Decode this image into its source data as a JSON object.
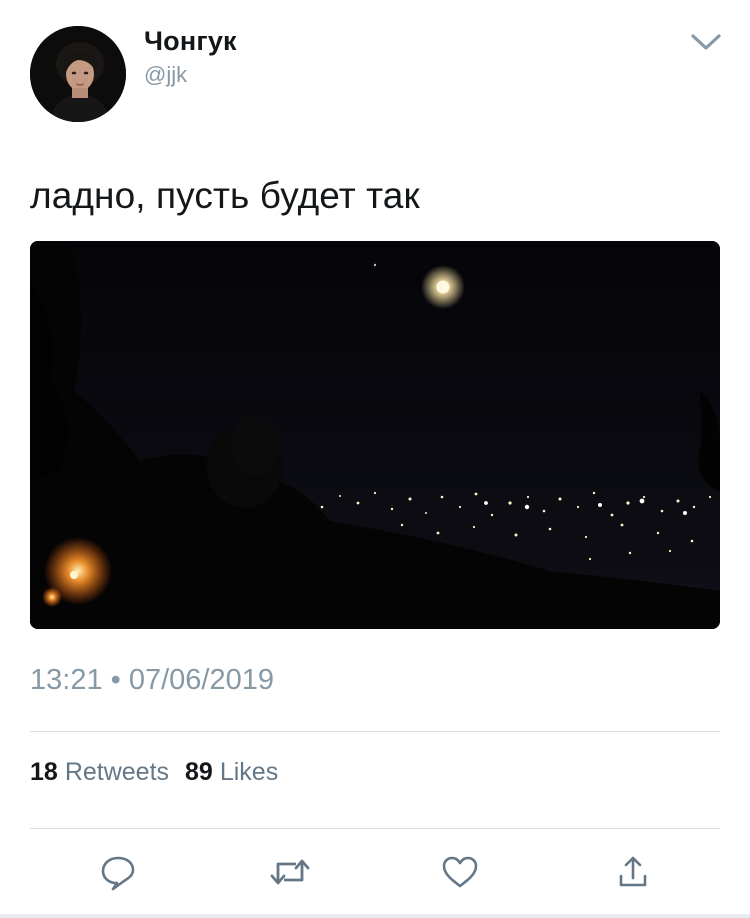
{
  "user": {
    "display_name": "Чонгук",
    "handle": "@jjk"
  },
  "tweet": {
    "text": "ладно, пусть будет так",
    "timestamp": "13:21 • 07/06/2019"
  },
  "stats": {
    "retweets_count": "18",
    "retweets_label": "Retweets",
    "likes_count": "89",
    "likes_label": "Likes"
  },
  "icons": {
    "menu": "chevron-down-icon",
    "reply": "reply-icon",
    "retweet": "retweet-icon",
    "like": "heart-icon",
    "share": "share-icon"
  },
  "colors": {
    "text_primary": "#14171a",
    "text_secondary": "#8899a6",
    "icon_gray": "#657786",
    "divider": "#d8dfe4"
  }
}
